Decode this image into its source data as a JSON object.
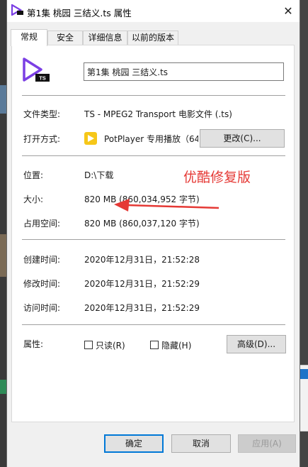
{
  "window": {
    "title": "第1集 桃园 三结义.ts 属性",
    "close_glyph": "✕"
  },
  "tabs": [
    {
      "label": "常规",
      "active": true
    },
    {
      "label": "安全",
      "active": false
    },
    {
      "label": "详细信息",
      "active": false
    },
    {
      "label": "以前的版本",
      "active": false
    }
  ],
  "file": {
    "name": "第1集 桃园 三结义.ts",
    "icon_badge": "TS"
  },
  "fields": {
    "type_label": "文件类型:",
    "type_value": "TS - MPEG2 Transport 电影文件 (.ts)",
    "open_with_label": "打开方式:",
    "open_with_value": "PotPlayer 专用播放（64",
    "change_button": "更改(C)...",
    "location_label": "位置:",
    "location_value": "D:\\下载",
    "size_label": "大小:",
    "size_value": "820 MB (860,034,952 字节)",
    "disk_size_label": "占用空间:",
    "disk_size_value": "820 MB (860,037,120 字节)",
    "created_label": "创建时间:",
    "created_value": "2020年12月31日，21:52:28",
    "modified_label": "修改时间:",
    "modified_value": "2020年12月31日，21:52:29",
    "accessed_label": "访问时间:",
    "accessed_value": "2020年12月31日，21:52:29",
    "attributes_label": "属性:",
    "readonly_label": "只读(R)",
    "hidden_label": "隐藏(H)",
    "advanced_button": "高级(D)..."
  },
  "annotation": {
    "text": "优酷修复版",
    "color": "#e53935"
  },
  "footer": {
    "ok": "确定",
    "cancel": "取消",
    "apply": "应用(A)"
  },
  "colors": {
    "accent": "#0078d7",
    "icon_purple": "#7b3fe4",
    "potplayer_yellow": "#f6c719"
  }
}
